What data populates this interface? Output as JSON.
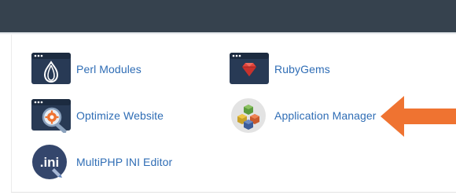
{
  "colors": {
    "topbar": "#36424e",
    "link": "#2f6db5",
    "icon_dark": "#283a55",
    "arrow": "#ef7331"
  },
  "apps": [
    {
      "label": "Perl Modules",
      "icon": "onion-icon"
    },
    {
      "label": "RubyGems",
      "icon": "ruby-gem-icon"
    },
    {
      "label": "Optimize Website",
      "icon": "magnifier-gear-icon"
    },
    {
      "label": "Application Manager",
      "icon": "cubes-icon"
    },
    {
      "label": "MultiPHP INI Editor",
      "icon": "ini-file-icon"
    }
  ]
}
